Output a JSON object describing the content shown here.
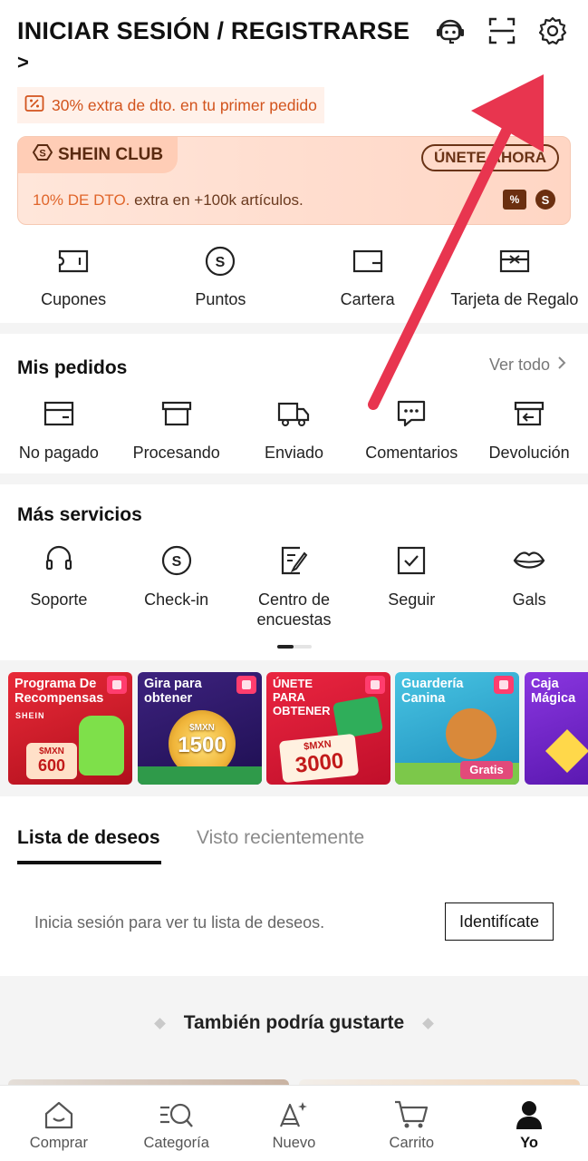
{
  "header": {
    "title": "INICIAR SESIÓN / REGISTRARSE",
    "arrow": ">",
    "promo": "30% extra de dto. en tu primer pedido"
  },
  "club": {
    "name": "SHEIN CLUB",
    "join": "ÚNETE AHORA",
    "text_highlight": "10% DE DTO.",
    "text_rest": " extra en +100k artículos.",
    "pct_badge": "%",
    "s_badge": "S"
  },
  "wallet": [
    {
      "label": "Cupones",
      "icon": "coupon-icon"
    },
    {
      "label": "Puntos",
      "icon": "points-icon"
    },
    {
      "label": "Cartera",
      "icon": "wallet-icon"
    },
    {
      "label": "Tarjeta de Regalo",
      "icon": "gift-card-icon"
    }
  ],
  "orders": {
    "title": "Mis pedidos",
    "see_all": "Ver todo",
    "items": [
      {
        "label": "No pagado",
        "icon": "unpaid-icon"
      },
      {
        "label": "Procesando",
        "icon": "processing-icon"
      },
      {
        "label": "Enviado",
        "icon": "shipped-icon"
      },
      {
        "label": "Comentarios",
        "icon": "comments-icon"
      },
      {
        "label": "Devolución",
        "icon": "return-icon"
      }
    ]
  },
  "services": {
    "title": "Más servicios",
    "items": [
      {
        "label": "Soporte",
        "icon": "headset-icon"
      },
      {
        "label": "Check-in",
        "icon": "checkin-icon"
      },
      {
        "label": "Centro de\nencuestas",
        "label_line1": "Centro de",
        "label_line2": "encuestas",
        "icon": "survey-icon"
      },
      {
        "label": "Seguir",
        "icon": "follow-icon"
      },
      {
        "label": "Gals",
        "icon": "lips-icon"
      }
    ]
  },
  "banners": [
    {
      "title_line1": "Programa De",
      "title_line2": "Recompensas",
      "sub": "SHEIN",
      "amount_line1": "$MXN",
      "amount_line2": "600",
      "color1": "#e02030",
      "color2": "#b3101d"
    },
    {
      "title_line1": "Gira para",
      "title_line2": "obtener",
      "amount_line1": "$MXN",
      "amount_line2": "1500",
      "color1": "#3a1e7a",
      "color2": "#21105a"
    },
    {
      "title_line1": "ÚNETE",
      "title_line2": "PARA",
      "title_line3": "OBTENER",
      "amount_line1": "$MXN",
      "amount_line2": "3000",
      "color1": "#e0203a",
      "color2": "#c0102a"
    },
    {
      "title_line1": "Guardería",
      "title_line2": "Canina",
      "amount_line2": "Gratis",
      "color1": "#3bb6d6",
      "color2": "#1f8fc0"
    },
    {
      "title_line1": "Caja",
      "title_line2": "Mágica",
      "color1": "#7a2fd0",
      "color2": "#5a18b0"
    }
  ],
  "tabs": {
    "wishlist": "Lista de deseos",
    "recent": "Visto recientemente"
  },
  "wishlist": {
    "message": "Inicia sesión para ver tu lista de deseos.",
    "button": "Identifícate"
  },
  "suggest": {
    "title": "También podría gustarte"
  },
  "nav": [
    {
      "label": "Comprar",
      "icon": "shop-icon"
    },
    {
      "label": "Categoría",
      "icon": "category-icon"
    },
    {
      "label": "Nuevo",
      "icon": "new-icon"
    },
    {
      "label": "Carrito",
      "icon": "cart-icon"
    },
    {
      "label": "Yo",
      "icon": "me-icon"
    }
  ],
  "colors": {
    "accent_red": "#e8354f",
    "promo_orange": "#d2531c",
    "club_bg": "#ffe0d2"
  }
}
